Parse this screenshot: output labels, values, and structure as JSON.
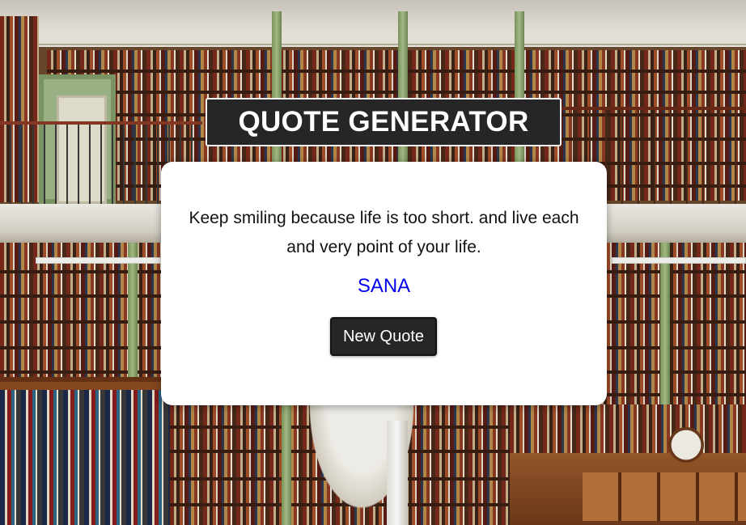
{
  "header": {
    "title": "QUOTE GENERATOR"
  },
  "quote": {
    "text": "Keep smiling because life is too short. and live each and very point of your life.",
    "author": "SANA"
  },
  "actions": {
    "new_quote_label": "New Quote"
  },
  "colors": {
    "title_background": "#262626",
    "author_text": "#0000ee",
    "button_background": "#262626",
    "card_background": "#ffffff"
  }
}
